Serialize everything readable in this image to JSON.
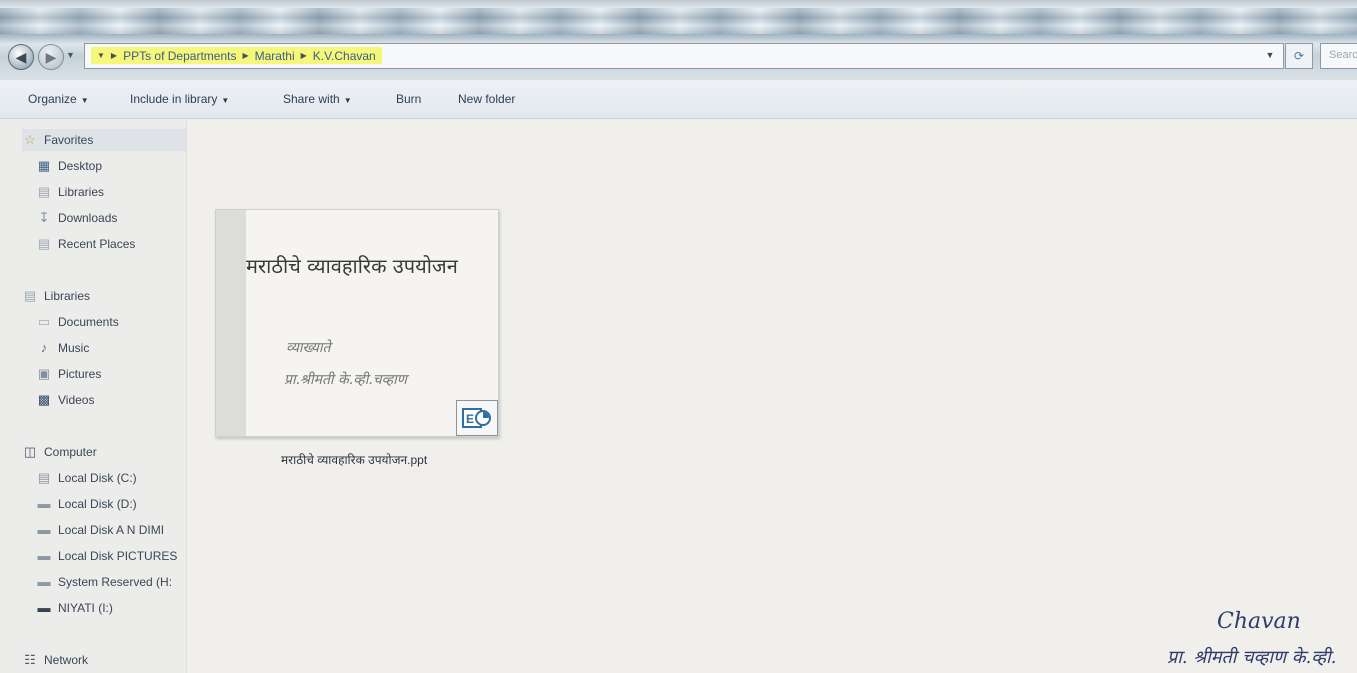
{
  "window": {
    "search_placeholder": "Search"
  },
  "address_bar": {
    "crumbs": [
      "PPTs of Departments",
      "Marathi",
      "K.V.Chavan"
    ]
  },
  "toolbar": {
    "organize": "Organize",
    "include_in_library": "Include in library",
    "share_with": "Share with",
    "burn": "Burn",
    "new_folder": "New folder"
  },
  "nav": {
    "favorites": {
      "label": "Favorites",
      "items": [
        "Desktop",
        "Libraries",
        "Downloads",
        "Recent Places"
      ]
    },
    "libraries": {
      "label": "Libraries",
      "items": [
        "Documents",
        "Music",
        "Pictures",
        "Videos"
      ]
    },
    "computer": {
      "label": "Computer",
      "items": [
        "Local Disk (C:)",
        "Local Disk (D:)",
        "Local Disk  A N DIMI",
        "Local Disk PICTURES",
        "System Reserved (H:",
        "NIYATI (I:)"
      ]
    },
    "network": {
      "label": "Network"
    }
  },
  "files": [
    {
      "name": "मराठीचे व्यावहारिक उपयोजन.ppt",
      "icon": "powerpoint-icon",
      "thumbnail": {
        "title": "मराठीचे व्यावहारिक उपयोजन",
        "line1": "व्याख्याते",
        "line2": "प्रा.श्रीमती के.व्ही.चव्हाण"
      }
    }
  ],
  "signature": {
    "name": "Chavan",
    "line2": "प्रा. श्रीमती चव्हाण के.व्ही."
  },
  "colors": {
    "breadcrumb_highlight": "#f5f77a",
    "link_text": "#3b5c8a",
    "signature_ink": "#2f3d6b"
  }
}
